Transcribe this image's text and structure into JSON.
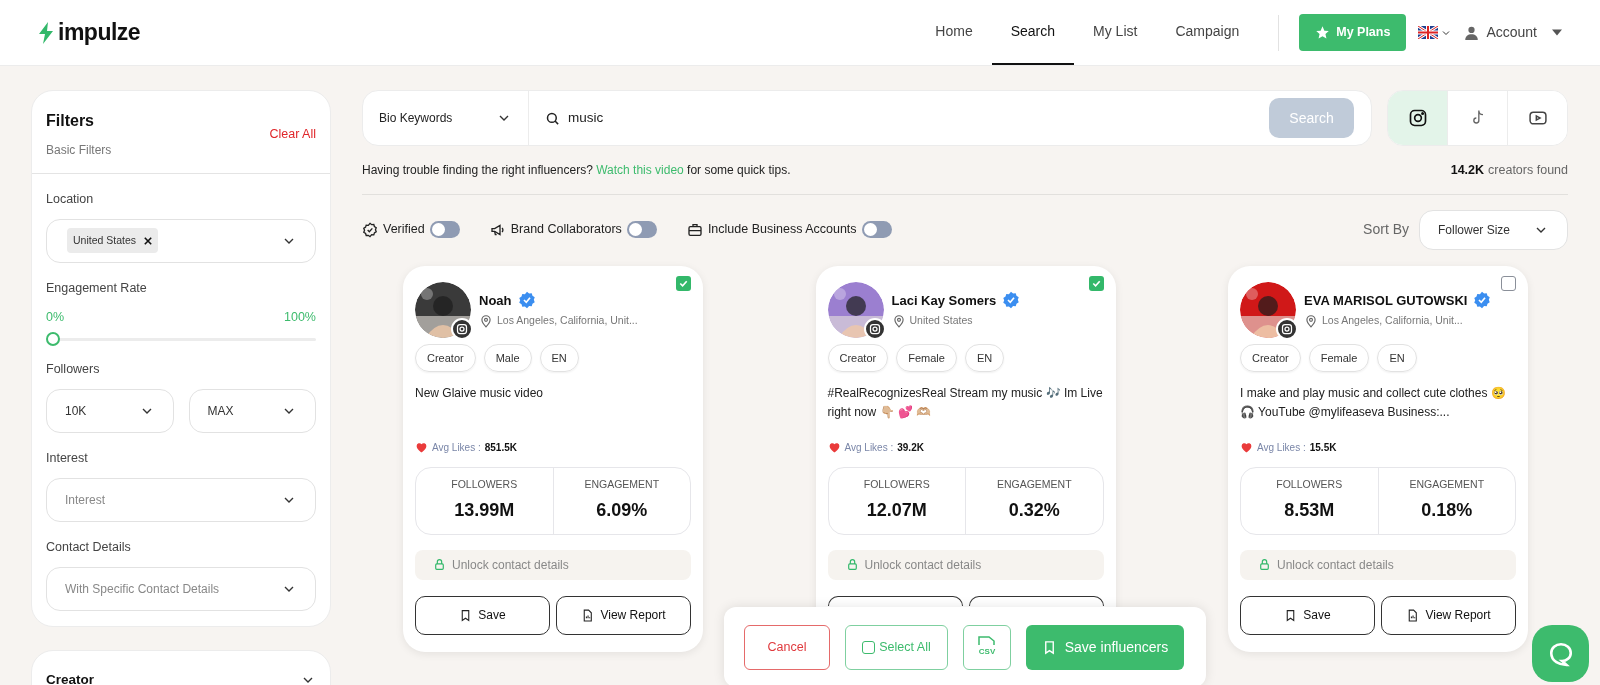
{
  "header": {
    "logo": "impulze",
    "nav": [
      {
        "label": "Home",
        "selected": false
      },
      {
        "label": "Search",
        "selected": true
      },
      {
        "label": "My List",
        "selected": false
      },
      {
        "label": "Campaign",
        "selected": false
      }
    ],
    "plans_button": "My Plans",
    "account": "Account"
  },
  "filters": {
    "title": "Filters",
    "subtitle": "Basic Filters",
    "clear": "Clear All",
    "location": {
      "label": "Location",
      "chips": [
        "United States"
      ]
    },
    "engagement": {
      "label": "Engagement Rate",
      "min": "0%",
      "max": "100%",
      "level": 0
    },
    "followers": {
      "label": "Followers",
      "from": "10K",
      "to": "MAX"
    },
    "interest": {
      "label": "Interest",
      "placeholder": "Interest"
    },
    "contact": {
      "label": "Contact Details",
      "placeholder": "With Specific Contact Details"
    }
  },
  "creator_section": {
    "title": "Creator",
    "expanded": false
  },
  "search": {
    "mode": "Bio Keywords",
    "value": "music",
    "button": "Search",
    "platforms": [
      {
        "kind": "instagram",
        "selected": true
      },
      {
        "kind": "tiktok",
        "selected": false
      },
      {
        "kind": "youtube",
        "selected": false
      }
    ]
  },
  "hint": {
    "before": "Having trouble finding the right influencers?",
    "link": "Watch this video",
    "after": "for some quick tips.",
    "count": "14.2K",
    "count_label": "creators found"
  },
  "toggles": [
    {
      "kind": "verified",
      "label": "Verified",
      "on": false
    },
    {
      "kind": "brand",
      "label": "Brand Collaborators",
      "on": false
    },
    {
      "kind": "business",
      "label": "Include Business Accounts",
      "on": false
    }
  ],
  "sort": {
    "label": "Sort By",
    "value": "Follower Size"
  },
  "cards": [
    {
      "name": "Noah",
      "verified": true,
      "location": "Los Angeles, California, Unit...",
      "checked": true,
      "tags": [
        "Creator",
        "Male",
        "EN"
      ],
      "bio": "New Glaive music video",
      "likes_label": "Avg Likes :",
      "likes": "851.5K",
      "followers_label": "FOLLOWERS",
      "followers": "13.99M",
      "engagement_label": "ENGAGEMENT",
      "engagement": "6.09%",
      "unlock": "Unlock contact details",
      "actions": [
        "Save",
        "View Report"
      ]
    },
    {
      "name": "Laci Kay Somers",
      "verified": true,
      "location": "United States",
      "checked": true,
      "tags": [
        "Creator",
        "Female",
        "EN"
      ],
      "bio": "#RealRecognizesReal Stream my music 🎶 Im Live right now 👇🏼 💕 🫶🏼",
      "likes_label": "Avg Likes :",
      "likes": "39.2K",
      "followers_label": "FOLLOWERS",
      "followers": "12.07M",
      "engagement_label": "ENGAGEMENT",
      "engagement": "0.32%",
      "unlock": "Unlock contact details"
    },
    {
      "name": "EVA MARISOL GUTOWSKI",
      "verified": true,
      "location": "Los Angeles, California, Unit...",
      "checked": false,
      "tags": [
        "Creator",
        "Female",
        "EN"
      ],
      "bio": "I make and play music and collect cute clothes 🥺 🎧 YouTube @mylifeaseva Business:...",
      "likes_label": "Avg Likes :",
      "likes": "15.5K",
      "followers_label": "FOLLOWERS",
      "followers": "8.53M",
      "engagement_label": "ENGAGEMENT",
      "engagement": "0.18%",
      "unlock": "Unlock contact details",
      "actions": [
        "Save",
        "View Report"
      ]
    }
  ],
  "bulk_bar": {
    "cancel": "Cancel",
    "select_all": "Select All",
    "csv": "CSV",
    "save": "Save influencers"
  }
}
